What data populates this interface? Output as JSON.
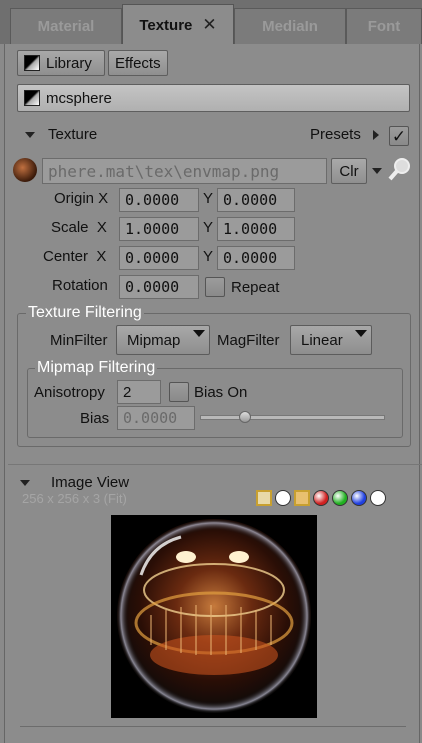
{
  "tabs": [
    {
      "label": "Material"
    },
    {
      "label": "Texture",
      "close": "✕"
    },
    {
      "label": "MediaIn"
    },
    {
      "label": "Font"
    }
  ],
  "toolbar": {
    "library_label": "Library",
    "effects_label": "Effects"
  },
  "material_name": "mcsphere",
  "texture_section": {
    "title": "Texture",
    "presets_label": "Presets",
    "presets_checked": "✓",
    "file_path": "phere.mat\\tex\\envmap.png",
    "clear_label": "Clr",
    "origin": {
      "label": "Origin X",
      "x": "0.0000",
      "y_label": "Y",
      "y": "0.0000"
    },
    "scale": {
      "label": "Scale  X",
      "x": "1.0000",
      "y_label": "Y",
      "y": "1.0000"
    },
    "center": {
      "label": "Center  X",
      "x": "0.0000",
      "y_label": "Y",
      "y": "0.0000"
    },
    "rotation": {
      "label": "Rotation",
      "value": "0.0000",
      "repeat_label": "Repeat"
    }
  },
  "texture_filtering": {
    "title": "Texture Filtering",
    "minfilter_label": "MinFilter",
    "minfilter_value": "Mipmap",
    "magfilter_label": "MagFilter",
    "magfilter_value": "Linear",
    "mipmap": {
      "title": "Mipmap Filtering",
      "anisotropy_label": "Anisotropy",
      "anisotropy_value": "2",
      "bias_on_label": "Bias On",
      "bias_label": "Bias",
      "bias_value": "0.0000",
      "bias_slider": 0.24
    }
  },
  "image_view": {
    "title": "Image View",
    "info": "256 x 256 x 3 (Fit)",
    "channel_buttons": [
      {
        "icon": "rgb-view-icon",
        "color": "#e8d9a8"
      },
      {
        "icon": "luminance-icon",
        "color": "#ffffff"
      },
      {
        "icon": "alpha-view-icon",
        "color": "#e8c070"
      },
      {
        "icon": "red-channel-icon",
        "color": "#d02020"
      },
      {
        "icon": "green-channel-icon",
        "color": "#20b020"
      },
      {
        "icon": "blue-channel-icon",
        "color": "#2040e0"
      },
      {
        "icon": "white-channel-icon",
        "color": "#ffffff"
      }
    ]
  }
}
